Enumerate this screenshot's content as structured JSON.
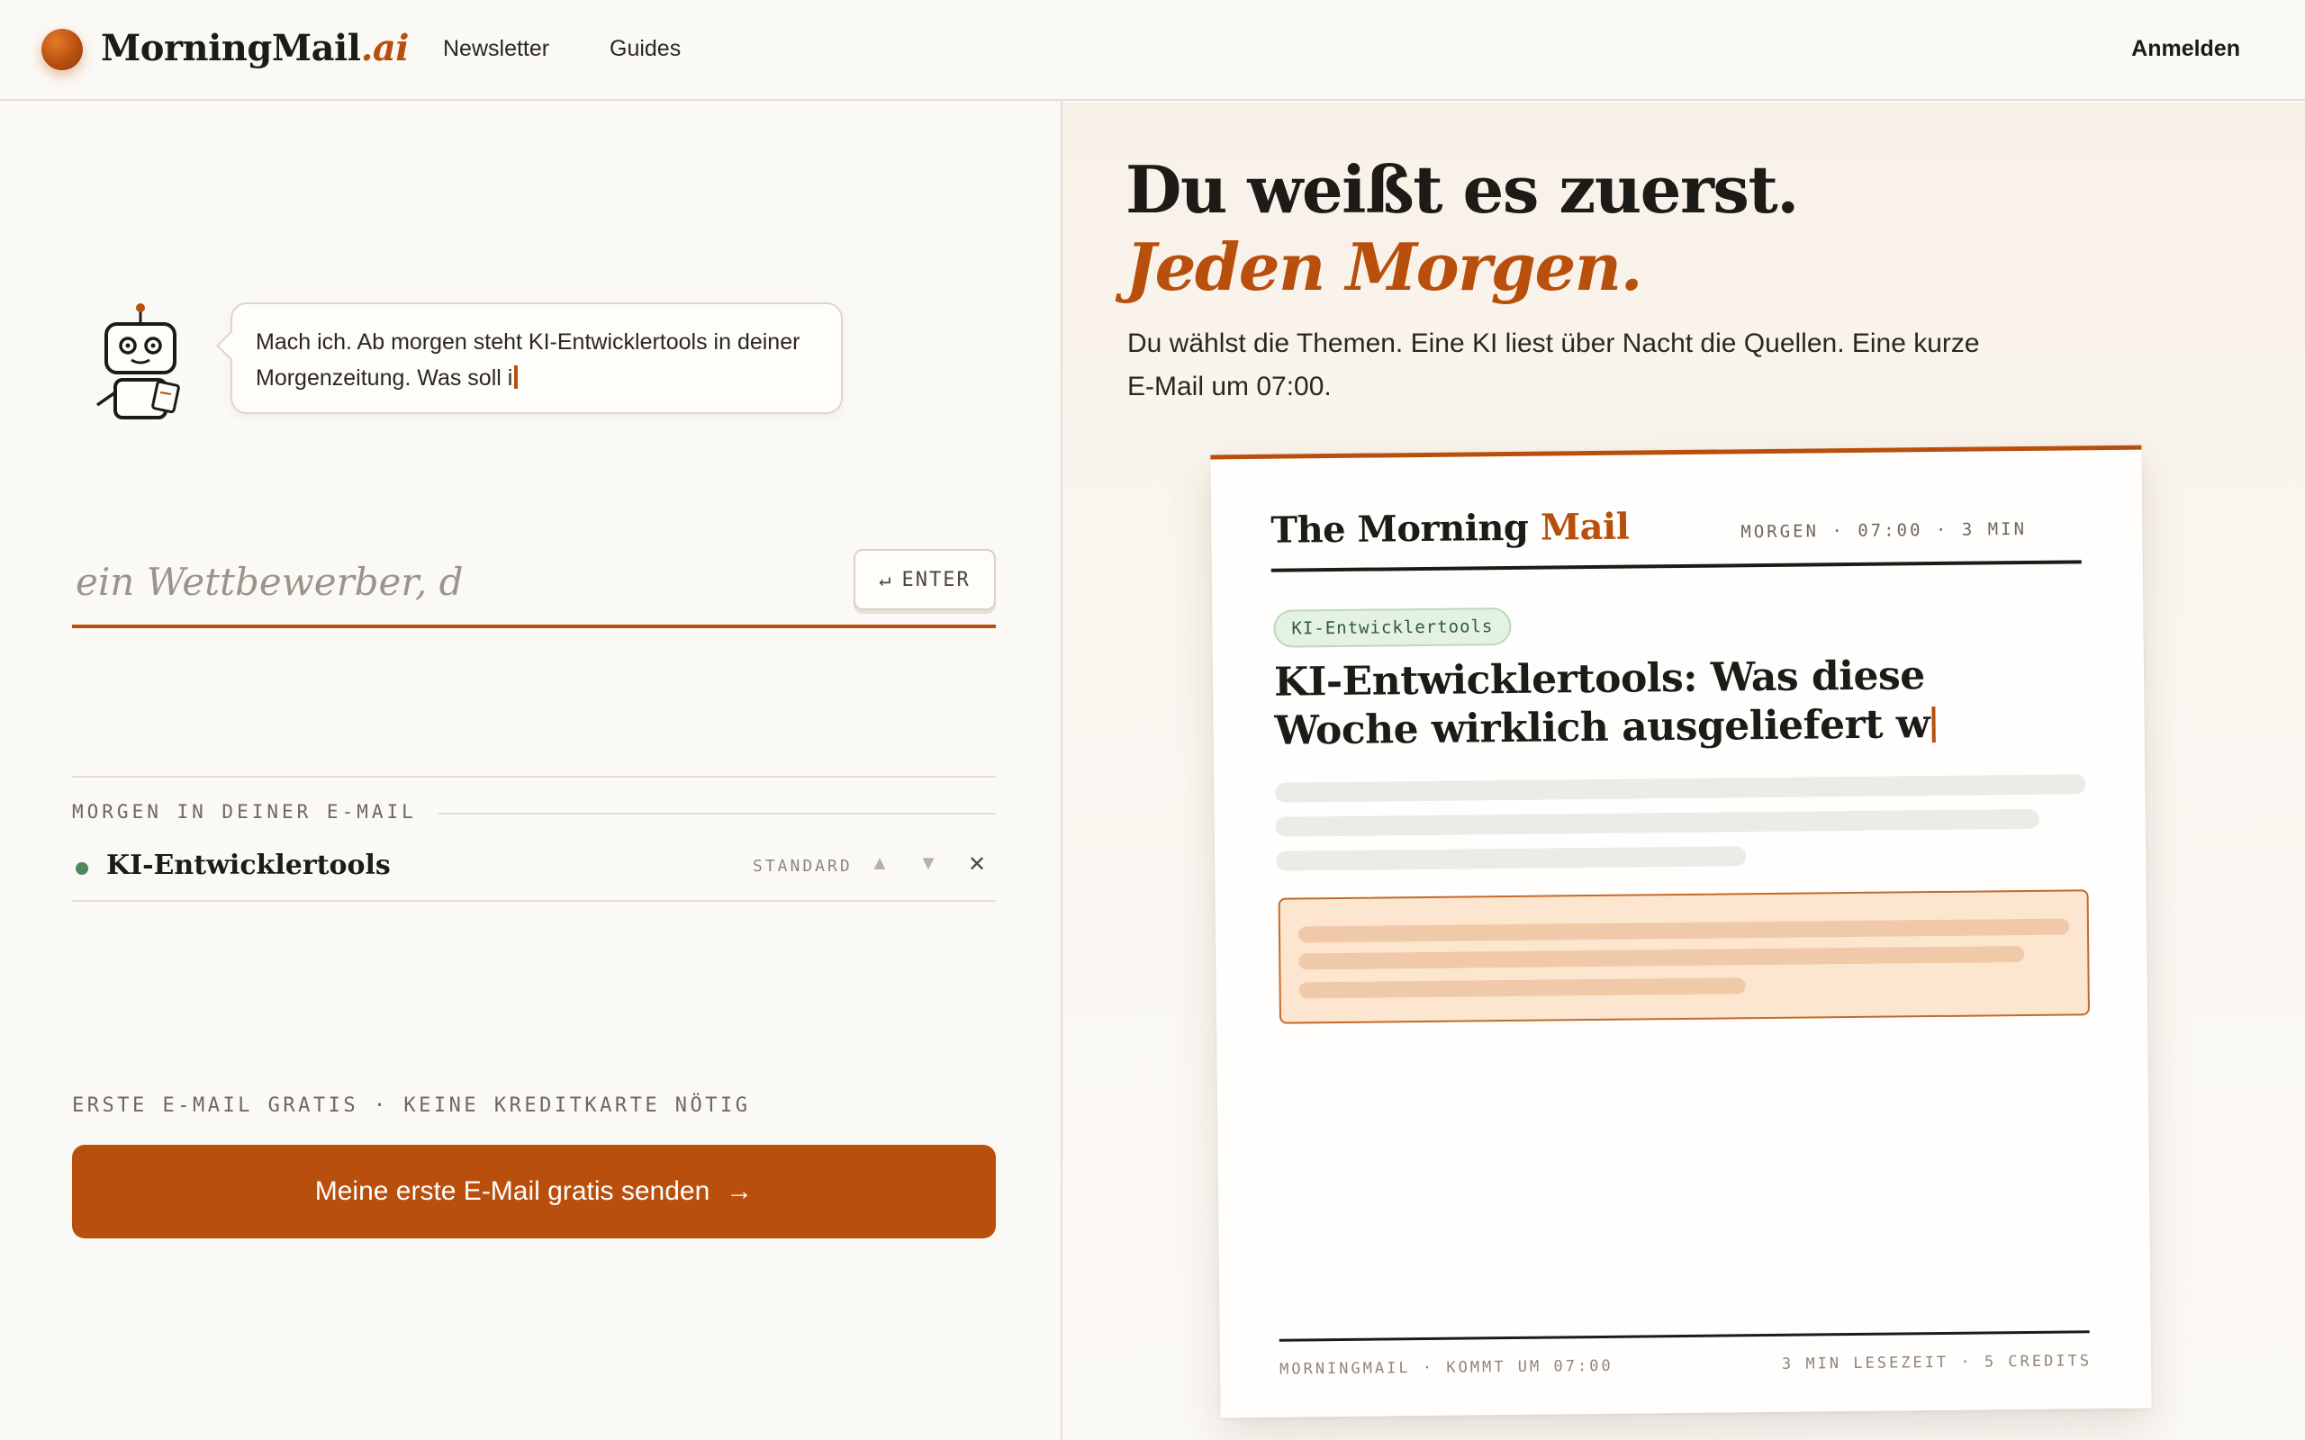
{
  "header": {
    "logo_main": "MorningMail",
    "logo_suffix": ".ai",
    "nav": [
      "Newsletter",
      "Guides"
    ],
    "login": "Anmelden"
  },
  "assistant": {
    "message": "Mach ich. Ab morgen steht KI-Entwicklertools in deiner Morgenzeitung. Was soll i"
  },
  "topic_input": {
    "placeholder": "ein Wettbewerber, d",
    "enter_label": "ENTER",
    "enter_icon": "return-icon"
  },
  "topics_section": {
    "label": "MORGEN IN DEINER E-MAIL",
    "items": [
      {
        "name": "KI-Entwicklertools",
        "badge": "STANDARD",
        "status_color": "#4f8a5e"
      }
    ]
  },
  "cta": {
    "note": "ERSTE E-MAIL GRATIS · KEINE KREDITKARTE NÖTIG",
    "button": "Meine erste E-Mail gratis senden",
    "icon": "arrow-right-icon"
  },
  "hero": {
    "title": "Du weißt es zuerst.",
    "subtitle": "Jeden Morgen.",
    "description": "Du wählst die Themen. Eine KI liest über Nacht die Quellen. Eine kurze E-Mail um 07:00."
  },
  "preview": {
    "brand_main": "The Morning",
    "brand_accent": "Mail",
    "meta": "MORGEN · 07:00 · 3 MIN",
    "tag": "KI-Entwicklertools",
    "headline": "KI-Entwicklertools: Was diese Woche wirklich ausgeliefert w",
    "footer_left": "MORNINGMAIL · KOMMT UM 07:00",
    "footer_right": "3 MIN LESEZEIT · 5 CREDITS"
  },
  "colors": {
    "accent": "#b84f0c",
    "background": "#fbf9f5",
    "tag_green": "#e3f2e3",
    "highlight": "#fde6cf"
  }
}
